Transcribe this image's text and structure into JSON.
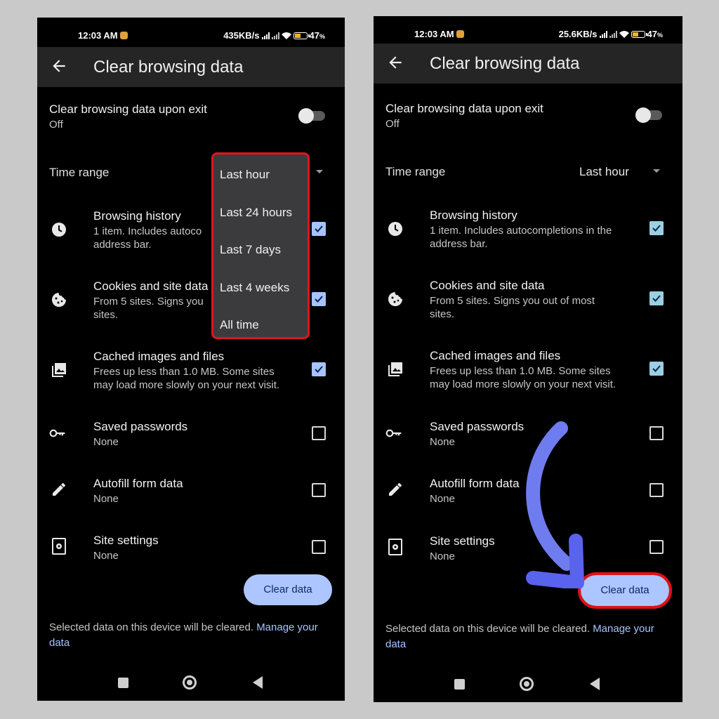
{
  "status_left": {
    "time": "12:03 AM",
    "speed": "435KB/s",
    "battery": "47",
    "battery_unit": "%"
  },
  "status_right": {
    "time": "12:03 AM",
    "speed": "25.6KB/s",
    "battery": "47",
    "battery_unit": "%"
  },
  "app_bar": {
    "title": "Clear browsing data"
  },
  "exit_setting": {
    "title": "Clear browsing data upon exit",
    "value": "Off"
  },
  "time_range": {
    "label": "Time range",
    "value": "Last hour"
  },
  "dropdown_options": [
    "Last hour",
    "Last 24 hours",
    "Last 7 days",
    "Last 4 weeks",
    "All time"
  ],
  "items_left": [
    {
      "title": "Browsing history",
      "desc": "1 item. Includes autoco\naddress bar.",
      "checked": true,
      "icon": "clock-icon"
    },
    {
      "title": "Cookies and site data",
      "desc": "From 5 sites. Signs you\nsites.",
      "checked": true,
      "icon": "cookie-icon"
    },
    {
      "title": "Cached images and files",
      "desc": "Frees up less than 1.0 MB. Some sites\nmay load more slowly on your next visit.",
      "checked": true,
      "icon": "image-icon"
    },
    {
      "title": "Saved passwords",
      "desc": "None",
      "checked": false,
      "icon": "key-icon"
    },
    {
      "title": "Autofill form data",
      "desc": "None",
      "checked": false,
      "icon": "pencil-icon"
    },
    {
      "title": "Site settings",
      "desc": "None",
      "checked": false,
      "icon": "site-settings-icon"
    }
  ],
  "items_right": [
    {
      "title": "Browsing history",
      "desc": "1 item. Includes autocompletions in the\naddress bar.",
      "checked": true,
      "icon": "clock-icon"
    },
    {
      "title": "Cookies and site data",
      "desc": "From 5 sites. Signs you out of most\nsites.",
      "checked": true,
      "icon": "cookie-icon"
    },
    {
      "title": "Cached images and files",
      "desc": "Frees up less than 1.0 MB. Some sites\nmay load more slowly on your next visit.",
      "checked": true,
      "icon": "image-icon"
    },
    {
      "title": "Saved passwords",
      "desc": "None",
      "checked": false,
      "icon": "key-icon"
    },
    {
      "title": "Autofill form data",
      "desc": "None",
      "checked": false,
      "icon": "pencil-icon"
    },
    {
      "title": "Site settings",
      "desc": "None",
      "checked": false,
      "icon": "site-settings-icon"
    }
  ],
  "clear_button": {
    "label": "Clear data"
  },
  "footer": {
    "text": "Selected data on this device will be cleared. ",
    "link": "Manage your data",
    "link_part1": "Manage your",
    "link_part2": "data"
  },
  "colors": {
    "accent": "#adc6ff",
    "highlight": "#e0141e",
    "arrow": "#6f7cf0"
  }
}
